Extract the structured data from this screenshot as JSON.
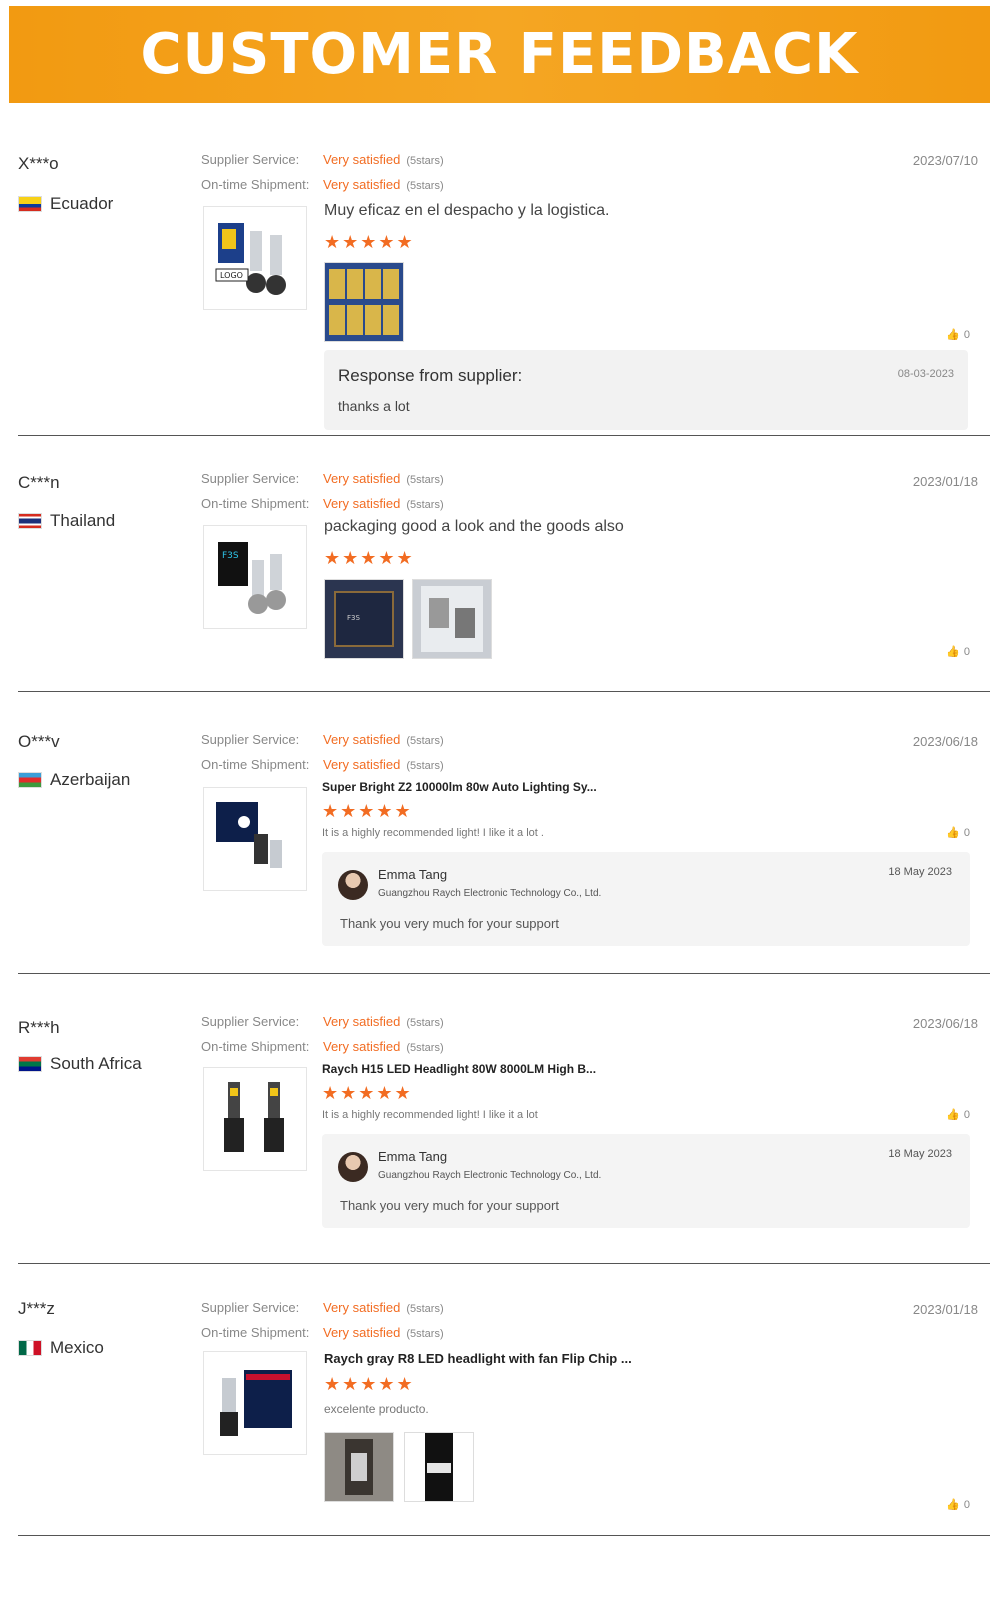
{
  "banner": {
    "title": "CUSTOMER FEEDBACK"
  },
  "labels": {
    "supplier_service": "Supplier Service:",
    "ontime_shipment": "On-time Shipment:",
    "very_satisfied": "Very satisfied",
    "five_stars": "(5stars)",
    "response_from_supplier": "Response from supplier:"
  },
  "star_glyphs": "★★★★★",
  "reviews": [
    {
      "buyer": "X***o",
      "country": "Ecuador",
      "date": "2023/07/10",
      "comment": "Muy eficaz en el despacho y la logistica.",
      "likes": "0",
      "response": {
        "date": "08-03-2023",
        "text": "thanks a lot"
      }
    },
    {
      "buyer": "C***n",
      "country": "Thailand",
      "date": "2023/01/18",
      "comment": "packaging good a look and the goods also",
      "likes": "0"
    },
    {
      "buyer": "O***v",
      "country": "Azerbaijan",
      "date": "2023/06/18",
      "product_title": "Super Bright Z2 10000lm 80w Auto Lighting Sy...",
      "comment": "It is a highly recommended light! I like it a lot .",
      "likes": "0",
      "reply": {
        "name": "Emma Tang",
        "company": "Guangzhou Raych Electronic Technology Co., Ltd.",
        "date": "18 May 2023",
        "text": "Thank you very much for your support"
      }
    },
    {
      "buyer": "R***h",
      "country": "South Africa",
      "date": "2023/06/18",
      "product_title": "Raych H15 LED Headlight 80W 8000LM High B...",
      "comment": "It is a highly recommended light! I like it a lot",
      "likes": "0",
      "reply": {
        "name": "Emma Tang",
        "company": "Guangzhou Raych Electronic Technology Co., Ltd.",
        "date": "18 May 2023",
        "text": "Thank you very much for your support"
      }
    },
    {
      "buyer": "J***z",
      "country": "Mexico",
      "date": "2023/01/18",
      "product_title": "Raych gray R8 LED headlight with fan Flip Chip ...",
      "comment": "excelente producto.",
      "likes": "0"
    }
  ]
}
